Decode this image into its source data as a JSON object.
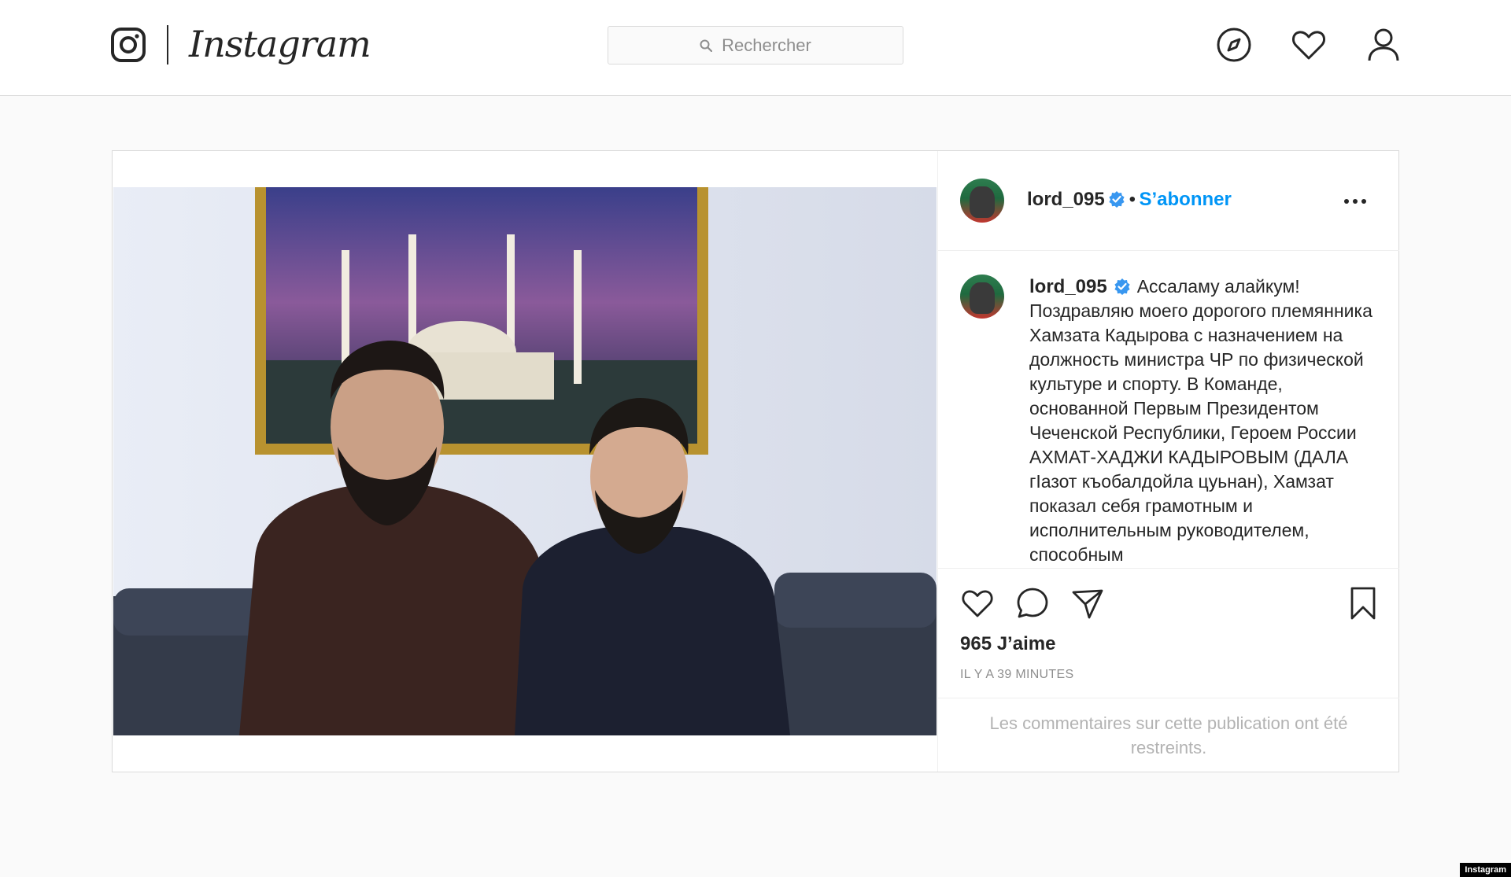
{
  "header": {
    "wordmark": "Instagram",
    "search_placeholder": "Rechercher",
    "icons": [
      "instagram-glyph-icon",
      "search-icon",
      "compass-icon",
      "heart-icon",
      "user-icon"
    ]
  },
  "post": {
    "author": {
      "username": "lord_095",
      "verified": true,
      "separator": "•",
      "follow_label": "S’abonner"
    },
    "caption": {
      "username": "lord_095",
      "text": "Ассаламу алайкум! Поздравляю моего дорогого племянника Хамзата Кадырова с назначением на должность министра ЧР по физической культуре и спорту. В Команде, основанной Первым Президентом Чеченской Республики, Героем России АХМАТ-ХАДЖИ КАДЫРОВЫМ (ДАЛА гIазот къобалдойла цуьнан), Хамзат показал себя грамотным и исполнительным руководителем, способным"
    },
    "likes": "965 J’aime",
    "time": "IL Y A 39 MINUTES",
    "comments_restricted": "Les commentaires sur cette publication ont été restreints.",
    "icons": [
      "more-options-icon",
      "like-icon",
      "comment-icon",
      "share-icon",
      "bookmark-icon"
    ]
  },
  "watermark": "Instagram",
  "colors": {
    "accent": "#0095f6",
    "border": "#dbdbdb",
    "background": "#fafafa",
    "muted_text": "#8e8e8e"
  }
}
